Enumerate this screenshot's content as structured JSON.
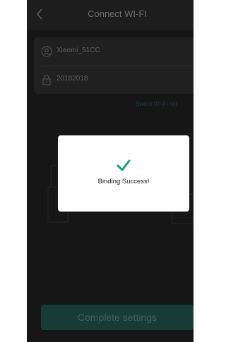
{
  "header": {
    "title": "Connect WI-FI"
  },
  "form": {
    "ssid": "Xiaomi_51CC",
    "password": "20182018"
  },
  "switch_network_label": "Switch WI-FI net",
  "complete_button_label": "Complete settings",
  "dialog": {
    "message": "Binding Success!",
    "icon": "checkmark-icon"
  },
  "colors": {
    "accent": "#1a9d84",
    "overlay_bg": "#161616"
  }
}
